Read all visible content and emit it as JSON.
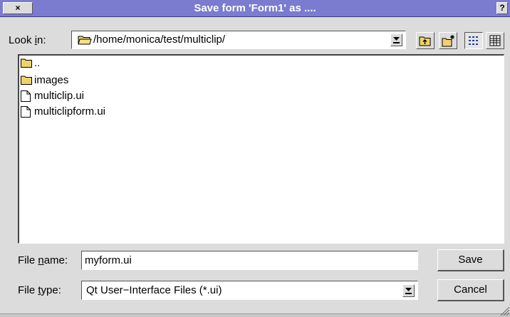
{
  "window": {
    "title": "Save form 'Form1' as ....",
    "close_label": "×",
    "help_label": "?"
  },
  "look_in": {
    "label_prefix": "Look ",
    "label_mnemonic": "i",
    "label_suffix": "n:",
    "path": "/home/monica/test/multiclip/"
  },
  "toolbar": {
    "buttons": [
      "parent-directory",
      "new-folder",
      "detail-view",
      "list-view"
    ]
  },
  "files": [
    {
      "name": "..",
      "kind": "folder"
    },
    {
      "name": "images",
      "kind": "folder"
    },
    {
      "name": "multiclip.ui",
      "kind": "file"
    },
    {
      "name": "multiclipform.ui",
      "kind": "file"
    }
  ],
  "file_name": {
    "label_prefix": "File ",
    "label_mnemonic": "n",
    "label_suffix": "ame:",
    "value": "myform.ui"
  },
  "file_type": {
    "label_prefix": "File ",
    "label_mnemonic": "t",
    "label_suffix": "ype:",
    "value": "Qt User−Interface Files (*.ui)"
  },
  "buttons": {
    "save": "Save",
    "cancel": "Cancel"
  },
  "colors": {
    "title_bar": "#7b7bd0",
    "window_bg": "#dcdcdc",
    "folder": "#f0d26a"
  }
}
